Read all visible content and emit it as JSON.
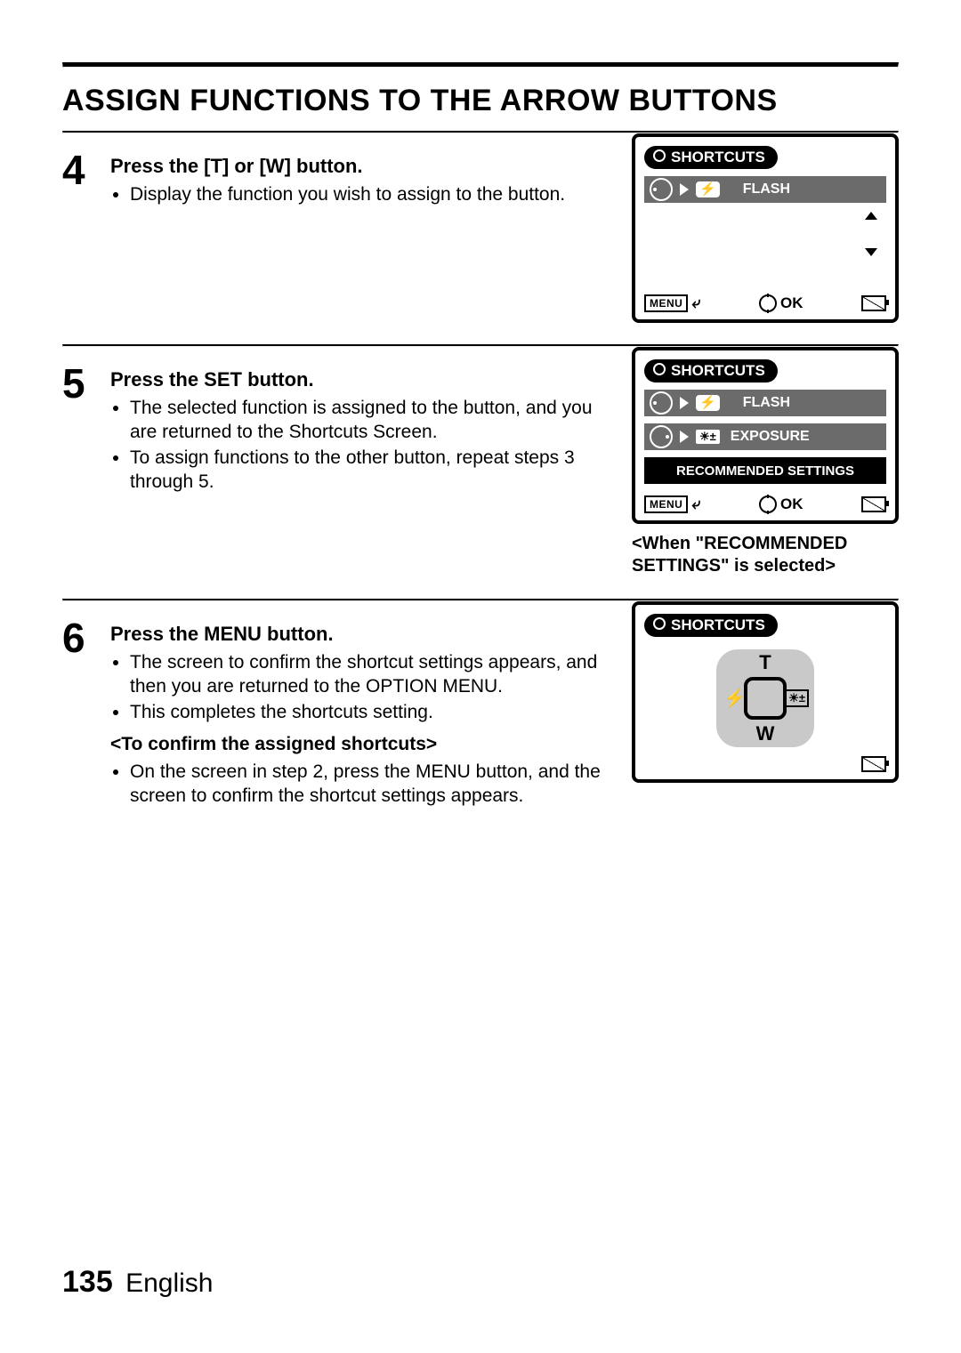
{
  "title": "ASSIGN FUNCTIONS TO THE ARROW BUTTONS",
  "steps": {
    "s4": {
      "num": "4",
      "head": "Press the [T] or [W] button.",
      "bullets": [
        "Display the function you wish to assign to the button."
      ]
    },
    "s5": {
      "num": "5",
      "head": "Press the SET button.",
      "bullets": [
        "The selected function is assigned to the button, and you are returned to the Shortcuts Screen.",
        "To assign functions to the other button, repeat steps 3 through 5."
      ]
    },
    "s6": {
      "num": "6",
      "head": "Press the MENU button.",
      "bullets": [
        "The screen to confirm the shortcut settings appears, and then you are returned to the OPTION MENU.",
        "This completes the shortcuts setting."
      ],
      "subhead": "<To confirm the assigned shortcuts>",
      "bullets2": [
        "On the screen in step 2, press the MENU button, and the screen to confirm the shortcut settings appears."
      ]
    }
  },
  "screens": {
    "shortcuts_label": "SHORTCUTS",
    "flash": "FLASH",
    "exposure": "EXPOSURE",
    "recommended": "RECOMMENDED SETTINGS",
    "menu": "MENU",
    "ok": "OK",
    "caption5": "<When \"RECOMMENDED SETTINGS\" is selected>",
    "joy": {
      "t": "T",
      "w": "W",
      "flash": "⚡",
      "exp": "☀±"
    }
  },
  "footer": {
    "page": "135",
    "lang": "English"
  }
}
